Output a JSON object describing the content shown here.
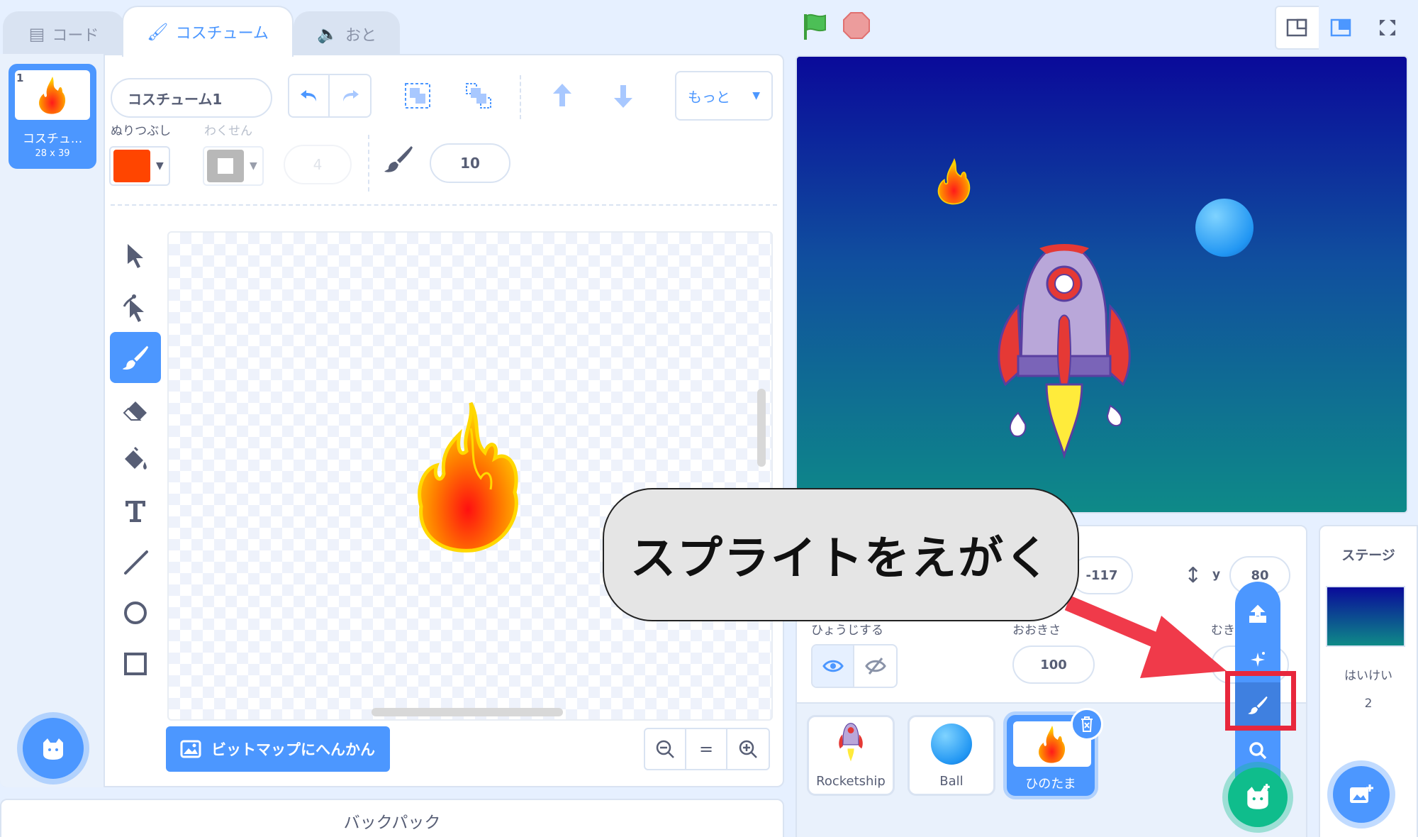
{
  "tabs": {
    "code": "コード",
    "costume": "コスチューム",
    "sound": "おと"
  },
  "costumes": [
    {
      "number": "1",
      "name": "コスチュ...",
      "size": "28 x 39"
    }
  ],
  "paint_editor": {
    "costume_name": "コスチューム1",
    "fill_label": "ぬりつぶし",
    "fill_color": "#ff4500",
    "outline_label": "わくせん",
    "outline_width": "4",
    "brush_size": "10",
    "more_label": "もっと",
    "convert_button": "ビットマップにへんかん",
    "zoom_reset": "="
  },
  "backpack_label": "バックパック",
  "sprite_info": {
    "x_value": "-117",
    "y_label": "y",
    "y_value": "80",
    "show_label": "ひょうじする",
    "size_label": "おおきさ",
    "size_value": "100",
    "direction_label": "むき"
  },
  "sprites": [
    {
      "name": "Rocketship"
    },
    {
      "name": "Ball"
    },
    {
      "name": "ひのたま"
    }
  ],
  "stage_panel": {
    "title": "ステージ",
    "backdrops_label": "はいけい",
    "backdrops_count": "2"
  },
  "callout_text": "スプライトをえがく",
  "colors": {
    "accent": "#4c97ff",
    "highlight": "#e8273c",
    "add_sprite": "#0fbd8c"
  }
}
